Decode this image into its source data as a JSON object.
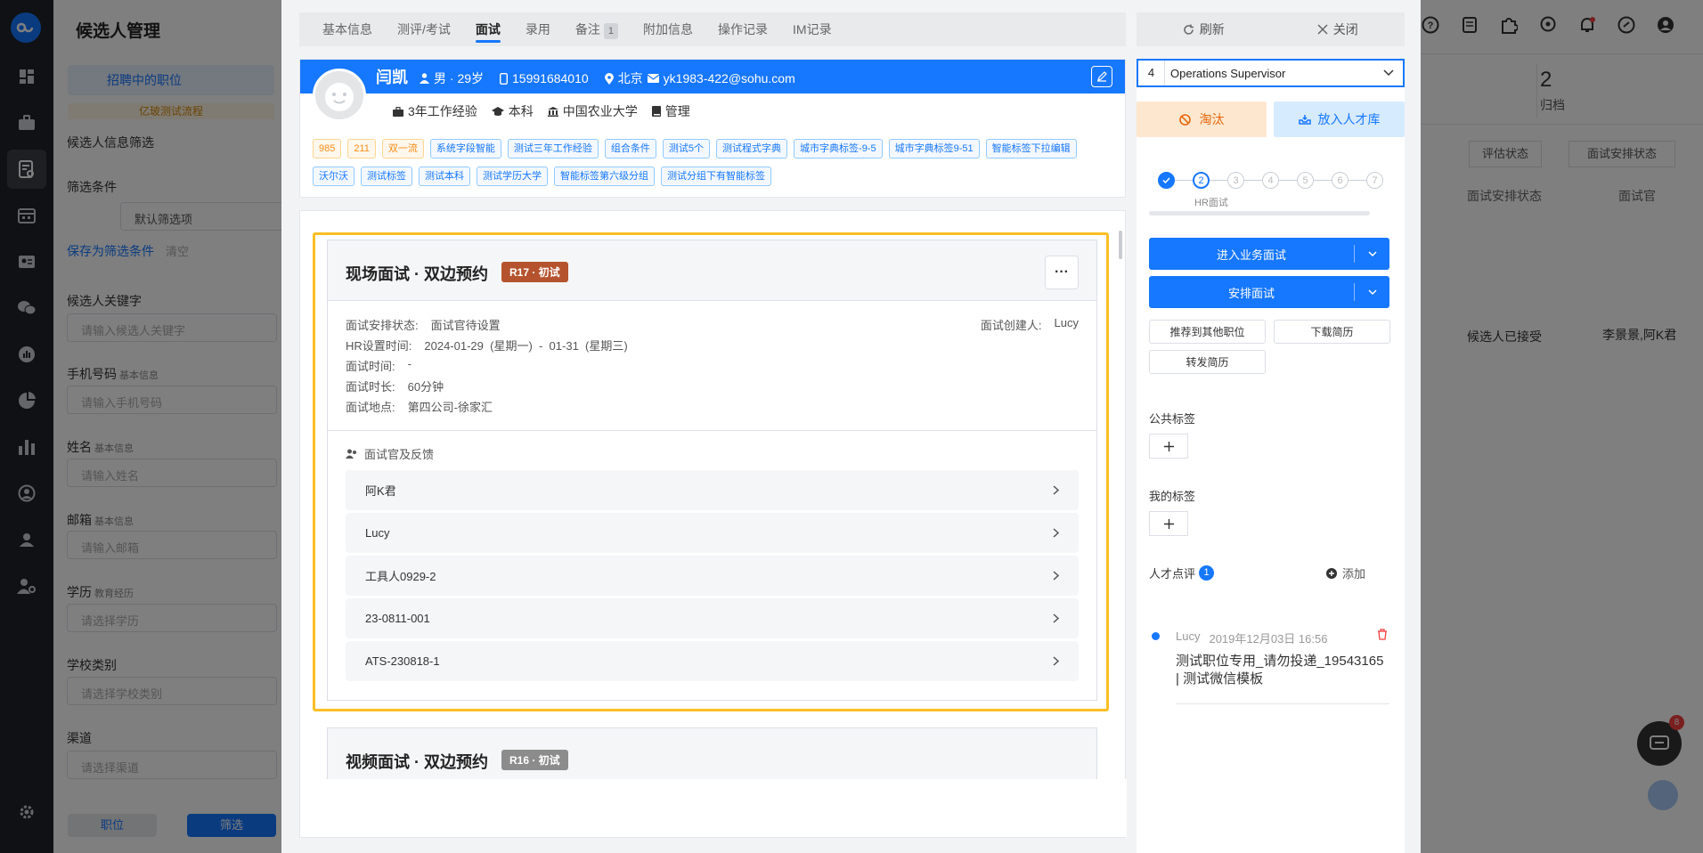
{
  "app": {
    "page_title": "候选人管理",
    "job_filter": "招聘中的职位",
    "flow_tag": "亿玻测试流程",
    "filter_title": "候选人信息筛选",
    "filter_cond_label": "筛选条件",
    "filter_cond_value": "默认筛选项",
    "save_filter": "保存为筛选条件",
    "clear": "清空",
    "fields": [
      {
        "label": "候选人关键字",
        "sub": "",
        "placeholder": "请输入候选人关键字"
      },
      {
        "label": "手机号码",
        "sub": "基本信息",
        "placeholder": "请输入手机号码"
      },
      {
        "label": "姓名",
        "sub": "基本信息",
        "placeholder": "请输入姓名"
      },
      {
        "label": "邮箱",
        "sub": "基本信息",
        "placeholder": "请输入邮箱"
      },
      {
        "label": "学历",
        "sub": "教育经历",
        "placeholder": "请选择学历"
      },
      {
        "label": "学校类别",
        "sub": "",
        "placeholder": "请选择学校类别"
      },
      {
        "label": "渠道",
        "sub": "",
        "placeholder": "请选择渠道"
      }
    ],
    "bottom_tabs": [
      "职位",
      "筛选"
    ],
    "right_bg": {
      "count": "2",
      "count_label": "归档",
      "filter1": "评估状态",
      "filter2": "面试安排状态",
      "col1": "面试安排状态",
      "col2": "面试官",
      "cell1": "候选人已接受",
      "cell2": "李景景,阿K君"
    },
    "chat_badge": "8"
  },
  "modal": {
    "tabs": [
      {
        "label": "基本信息",
        "badge": ""
      },
      {
        "label": "测评/考试",
        "badge": ""
      },
      {
        "label": "面试",
        "badge": ""
      },
      {
        "label": "录用",
        "badge": ""
      },
      {
        "label": "备注",
        "badge": "1"
      },
      {
        "label": "附加信息",
        "badge": ""
      },
      {
        "label": "操作记录",
        "badge": ""
      },
      {
        "label": "IM记录",
        "badge": ""
      }
    ],
    "active_tab": "面试",
    "refresh": "刷新",
    "close": "关闭",
    "candidate": {
      "name": "闫凯",
      "gender_age": "男 · 29岁",
      "phone": "15991684010",
      "city": "北京",
      "email": "yk1983-422@sohu.com",
      "experience": "3年工作经验",
      "degree": "本科",
      "school": "中国农业大学",
      "major": "管理",
      "tags": [
        {
          "text": "985",
          "color": "orange"
        },
        {
          "text": "211",
          "color": "orange"
        },
        {
          "text": "双一流",
          "color": "orange"
        },
        {
          "text": "系统字段智能",
          "color": "blue"
        },
        {
          "text": "测试三年工作经验",
          "color": "blue"
        },
        {
          "text": "组合条件",
          "color": "blue"
        },
        {
          "text": "测试5个",
          "color": "blue"
        },
        {
          "text": "测试程式字典",
          "color": "blue"
        },
        {
          "text": "城市字典标签-9-5",
          "color": "blue"
        },
        {
          "text": "城市字典标签9-51",
          "color": "blue"
        },
        {
          "text": "智能标签下拉编辑",
          "color": "blue"
        },
        {
          "text": "沃尔沃",
          "color": "blue"
        },
        {
          "text": "测试标签",
          "color": "blue"
        },
        {
          "text": "测试本科",
          "color": "blue"
        },
        {
          "text": "测试学历大学",
          "color": "blue"
        },
        {
          "text": "智能标签第六级分组",
          "color": "blue"
        },
        {
          "text": "测试分组下有智能标签",
          "color": "blue"
        }
      ]
    },
    "interview1": {
      "title": "现场面试 · 双边预约",
      "round": "R17 · 初试",
      "status_label": "面试安排状态:",
      "status": "面试官待设置",
      "creator_label": "面试创建人:",
      "creator": "Lucy",
      "hr_time_label": "HR设置时间:",
      "hr_time": "2024-01-29  (星期一)  -  01-31  (星期三)",
      "time_label": "面试时间:",
      "time": "-",
      "duration_label": "面试时长:",
      "duration": "60分钟",
      "location_label": "面试地点:",
      "location": "第四公司-徐家汇",
      "feedback_title": "面试官及反馈",
      "interviewers": [
        "阿K君",
        "Lucy",
        "工具人0929-2",
        "23-0811-001",
        "ATS-230818-1"
      ]
    },
    "interview2": {
      "title": "视频面试 · 双边预约",
      "round": "R16 · 初试"
    },
    "side": {
      "job_num": "4",
      "job": "Operations Supervisor",
      "eliminate": "淘汰",
      "to_pool": "放入人才库",
      "steps": [
        "1",
        "2",
        "3",
        "4",
        "5",
        "6",
        "7"
      ],
      "current_step": "HR面试",
      "btn_business": "进入业务面试",
      "btn_arrange": "安排面试",
      "btn_recommend": "推荐到其他职位",
      "btn_download": "下载简历",
      "btn_forward": "转发简历",
      "public_tags": "公共标签",
      "my_tags": "我的标签",
      "comments_label": "人才点评",
      "comments_count": "1",
      "add": "添加",
      "comment": {
        "author": "Lucy",
        "time": "2019年12月03日 16:56",
        "text": "测试职位专用_请勿投递_19543165 | 测试微信模板"
      }
    }
  }
}
